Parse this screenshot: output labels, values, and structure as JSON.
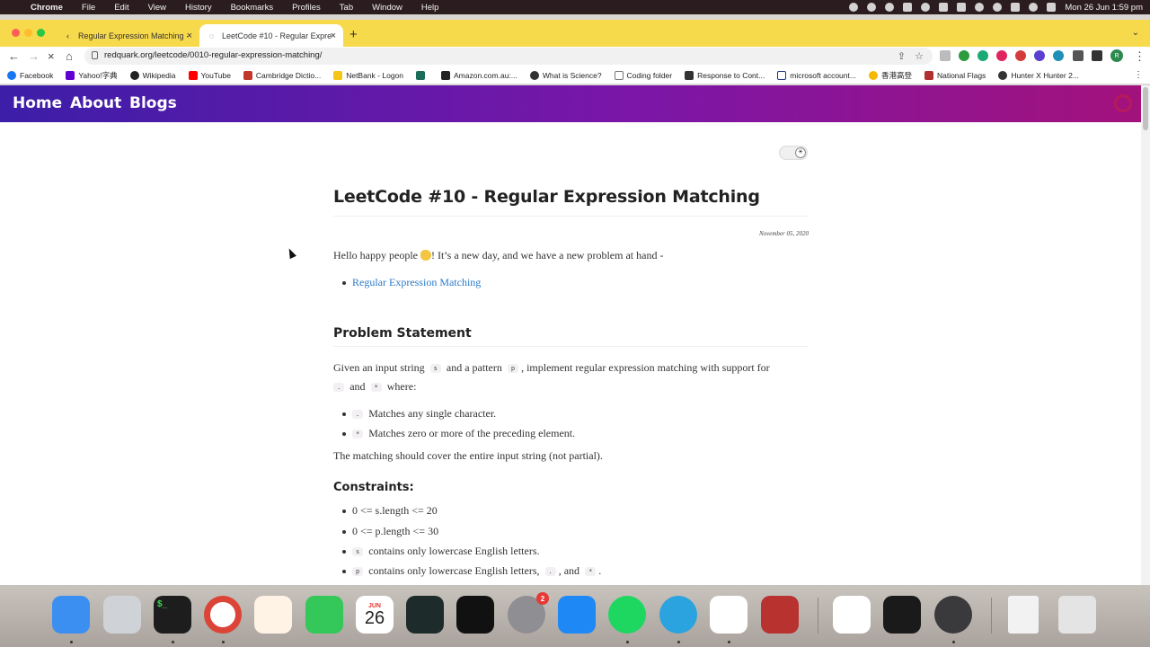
{
  "menubar": {
    "app_name": "Chrome",
    "items": [
      "File",
      "Edit",
      "View",
      "History",
      "Bookmarks",
      "Profiles",
      "Tab",
      "Window",
      "Help"
    ],
    "clock": "Mon 26 Jun  1:59 pm"
  },
  "tabs": [
    {
      "title": "Regular Expression Matching ·",
      "active": false
    },
    {
      "title": "LeetCode #10 - Regular Expre",
      "active": true
    }
  ],
  "toolbar": {
    "url": "redquark.org/leetcode/0010-regular-expression-matching/",
    "profile_initial": "R"
  },
  "bookmarks": [
    {
      "label": "Facebook",
      "color": "#1877f2"
    },
    {
      "label": "Yahoo!字典",
      "color": "#6001d2"
    },
    {
      "label": "Wikipedia",
      "color": "#222222"
    },
    {
      "label": "YouTube",
      "color": "#ff0000"
    },
    {
      "label": "Cambridge Dictio...",
      "color": "#c0392b"
    },
    {
      "label": "NetBank - Logon",
      "color": "#f5c518"
    },
    {
      "label": "",
      "color": "#1b6d5a"
    },
    {
      "label": "Amazon.com.au:...",
      "color": "#222222"
    },
    {
      "label": "What is Science?",
      "color": "#333333"
    },
    {
      "label": "Coding folder",
      "color": "#777777"
    },
    {
      "label": "Response to Cont...",
      "color": "#333333"
    },
    {
      "label": "microsoft account...",
      "color": "#1a3a8a"
    },
    {
      "label": "香港高登",
      "color": "#f5b800"
    },
    {
      "label": "National Flags",
      "color": "#b03030"
    },
    {
      "label": "Hunter X Hunter 2...",
      "color": "#333333"
    }
  ],
  "site_nav": {
    "home": "Home",
    "about": "About",
    "blogs": "Blogs"
  },
  "article": {
    "title": "LeetCode #10 - Regular Expression Matching",
    "date": "November 05, 2020",
    "intro_before": "Hello happy people ",
    "intro_after": "! It’s a new day, and we have a new problem at hand -",
    "problem_link": "Regular Expression Matching",
    "problem_heading": "Problem Statement",
    "statement": {
      "p1": "Given an input string",
      "code_s": "s",
      "p2": "and a pattern",
      "code_p": "p",
      "p3": ", implement regular expression matching with support for",
      "code_dot": ".",
      "p4": "and",
      "code_star": "*",
      "p5": "where:"
    },
    "rules": [
      {
        "code": ".",
        "text": "Matches any single character."
      },
      {
        "code": "*",
        "text": "Matches zero or more of the preceding element."
      }
    ],
    "coverage": "The matching should cover the entire input string (not partial).",
    "constraints_heading": "Constraints:",
    "constraints": {
      "c1": "0 <= s.length <= 20",
      "c2": "0 <= p.length <= 30",
      "c3_code": "s",
      "c3": "contains only lowercase English letters.",
      "c4_code": "p",
      "c4": "contains only lowercase English letters,",
      "c4_dot": ".",
      "c4_and": ", and",
      "c4_star": "*",
      "c4_end": "."
    }
  },
  "dock": {
    "calendar_month": "JUN",
    "calendar_day": "26",
    "settings_badge": "2",
    "terminal_label": "$_"
  }
}
